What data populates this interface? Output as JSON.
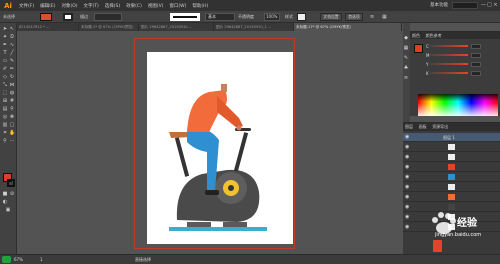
{
  "app": {
    "logo": "Ai",
    "menu": [
      "文件(F)",
      "编辑(E)",
      "对象(O)",
      "文字(T)",
      "选择(S)",
      "效果(C)",
      "视图(V)",
      "窗口(W)",
      "帮助(H)"
    ],
    "workspace": "基本功能",
    "window_buttons": [
      "—",
      "□",
      "×"
    ]
  },
  "control_bar": {
    "stroke_label": "描边",
    "style_label": "基本",
    "opacity_label": "不透明度",
    "opacity_value": "100%",
    "style2_label": "样式",
    "doc_setup": "文档设置",
    "prefs": "首选项",
    "colors": {
      "fill": "#d9502f",
      "stroke": "#222222"
    }
  },
  "tabs": [
    {
      "label": "8214247612 * ...",
      "active": false
    },
    {
      "label": "未标题-1* @ 67% (CMYK/预览)",
      "active": false
    },
    {
      "label": "图片 29642867_20190910 ...",
      "active": false
    },
    {
      "label": "图片 29642867_20190910_1 ...",
      "active": false
    },
    {
      "label": "未标题-17* @ 67% (CMYK/预览)",
      "active": true
    }
  ],
  "right_panel": {
    "color_tabs": [
      "颜色",
      "颜色参考"
    ],
    "sliders": [
      {
        "letter": "C",
        "value": ""
      },
      {
        "letter": "M",
        "value": ""
      },
      {
        "letter": "Y",
        "value": ""
      },
      {
        "letter": "K",
        "value": ""
      }
    ],
    "layer_tabs": [
      "图层",
      "画板",
      "资源导出"
    ],
    "layers": [
      "图层 1",
      "",
      "",
      "",
      "",
      "",
      "",
      "",
      "",
      "",
      ""
    ]
  },
  "status_bar": {
    "zoom": "67%",
    "artboard": "1",
    "tool": "直接选择"
  },
  "watermark": {
    "name": "经验",
    "url": "jingyan.baidu.com"
  },
  "colors": {
    "shirt": "#f26b3a",
    "pants": "#2e8fd1",
    "bike": "#4a4a4a",
    "seat": "#c0703a",
    "wheel": "#f2c22e",
    "base": "#3ab0c8"
  }
}
